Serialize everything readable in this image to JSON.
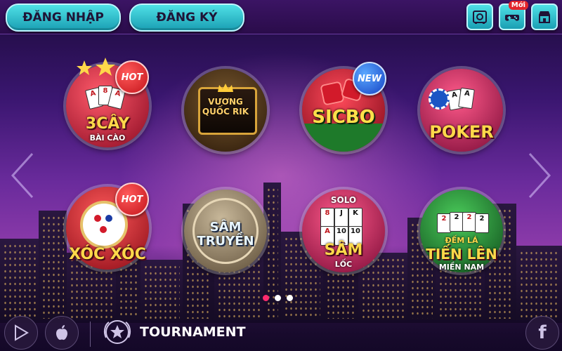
{
  "header": {
    "login_label": "ĐĂNG NHẬP",
    "register_label": "ĐĂNG KÝ",
    "new_badge": "Mới",
    "icons": [
      "safe-icon",
      "gamepad-icon",
      "shop-icon"
    ]
  },
  "games": [
    {
      "name": "3CÂY",
      "sub": "BÀI CÀO",
      "tag": "HOT",
      "color": "#c01a3a"
    },
    {
      "name": "VƯƠNG QUỐC RIK",
      "sub": "",
      "tag": "",
      "color": "#3a2a14"
    },
    {
      "name": "SICBO",
      "sub": "",
      "tag": "NEW",
      "color": "#1e7a2a"
    },
    {
      "name": "POKER",
      "sub": "",
      "tag": "",
      "color": "#b0124a"
    },
    {
      "name": "XÓC XÓC",
      "sub": "",
      "tag": "HOT",
      "color": "#b51626"
    },
    {
      "name": "SÂM TRUYỀN",
      "sub": "",
      "tag": "",
      "color": "#7a6a55"
    },
    {
      "name": "SÂM",
      "sub": "LỐC",
      "tag": "",
      "top": "SOLO",
      "color": "#c0124a"
    },
    {
      "name": "TIẾN LÊN",
      "sub": "MIỀN NAM",
      "tag": "",
      "top": "ĐẾM LÁ",
      "color": "#1a7a2a"
    }
  ],
  "cards": {
    "three_cay": [
      "A",
      "8",
      "A"
    ],
    "solo": [
      "8",
      "J",
      "K",
      "A",
      "10",
      "10"
    ],
    "tien_len": [
      "2",
      "2",
      "2",
      "2"
    ]
  },
  "pager": {
    "total": 3,
    "active": 0
  },
  "footer": {
    "tournament_label": "TOURNAMENT",
    "facebook_label": "f"
  },
  "colors": {
    "accent_cyan": "#4fe0e6",
    "hot_red": "#e3242b",
    "new_blue": "#1643c4",
    "pager_active": "#ff2a6d"
  }
}
